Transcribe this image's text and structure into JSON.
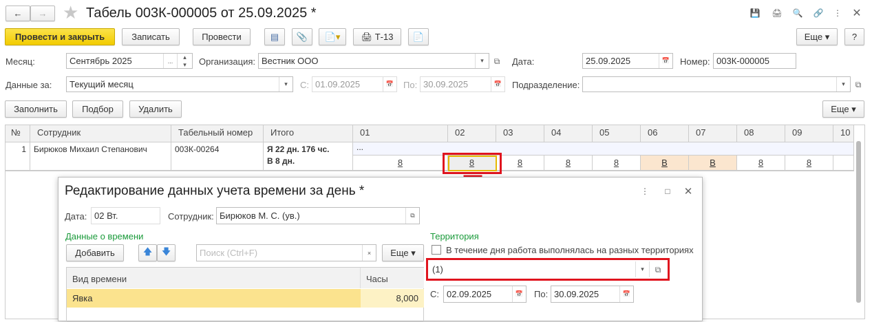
{
  "title": "Табель 003К-000005 от 25.09.2025 *",
  "toolbar": {
    "post_close": "Провести и закрыть",
    "save": "Записать",
    "post": "Провести",
    "t13": "Т-13",
    "more": "Еще",
    "help": "?"
  },
  "form": {
    "month_label": "Месяц:",
    "month_value": "Сентябрь 2025",
    "org_label": "Организация:",
    "org_value": "Вестник ООО",
    "date_label": "Дата:",
    "date_value": "25.09.2025",
    "number_label": "Номер:",
    "number_value": "003К-000005",
    "data_for_label": "Данные за:",
    "data_for_value": "Текущий месяц",
    "from_label": "С:",
    "from_value": "01.09.2025",
    "to_label": "По:",
    "to_value": "30.09.2025",
    "dept_label": "Подразделение:",
    "dept_value": ""
  },
  "table_toolbar": {
    "fill": "Заполнить",
    "select": "Подбор",
    "delete": "Удалить",
    "more": "Еще"
  },
  "table": {
    "headers": [
      "№",
      "Сотрудник",
      "Табельный номер",
      "Итого",
      "01",
      "02",
      "03",
      "04",
      "05",
      "06",
      "07",
      "08",
      "09",
      "10"
    ],
    "row": {
      "num": "1",
      "employee": "Бирюков Михаил Степанович",
      "tab_number": "003К-00264",
      "total_line1": "Я 22 дн. 176 чс.",
      "total_line2": "В 8 дн.",
      "dots": "...",
      "days": [
        "8",
        "8",
        "8",
        "8",
        "8",
        "В",
        "В",
        "8",
        "8"
      ]
    }
  },
  "dialog": {
    "title": "Редактирование данных учета времени за день *",
    "date_label": "Дата:",
    "date_value": "02 Вт.",
    "employee_label": "Сотрудник:",
    "employee_value": "Бирюков М. С. (ув.)",
    "time_section": "Данные о времени",
    "add": "Добавить",
    "search_placeholder": "Поиск (Ctrl+F)",
    "more": "Еще",
    "col_type": "Вид времени",
    "col_hours": "Часы",
    "row_type": "Явка",
    "row_hours": "8,000",
    "territory_section": "Территория",
    "checkbox_label": "В течение дня работа выполнялась на разных территориях",
    "territory_value": "(1)",
    "from_label": "С:",
    "from_value": "02.09.2025",
    "to_label": "По:",
    "to_value": "30.09.2025"
  }
}
